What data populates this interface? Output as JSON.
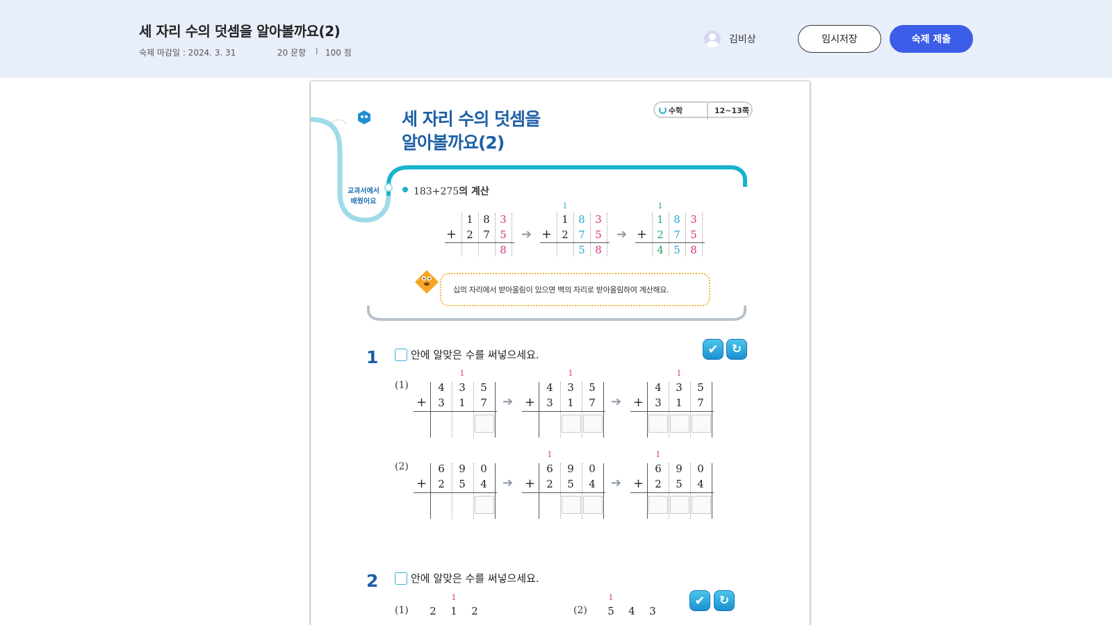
{
  "header": {
    "title": "세 자리 수의 덧셈을 알아볼까요(2)",
    "due_label": "숙제 마감일 : 2024. 3. 31",
    "question_count": "20 문항",
    "separator": "I",
    "points": "100 점",
    "user_name": "김비상",
    "save_label": "임시저장",
    "submit_label": "숙제 제출"
  },
  "sheet": {
    "title": "세 자리 수의 덧셈을\n알아볼까요(2)",
    "subject": "수학",
    "pages": "12~13쪽",
    "learned_label": "교과서에서\n배웠어요",
    "calc_title_expr": "183+275",
    "calc_title_suffix": "의 계산",
    "tip": "십의 자리에서 받아올림이 있으면 백의 자리로 받아올림하여 계산해요.",
    "q1": {
      "number": "1",
      "instruction": "안에 알맞은 수를 써넣으세요.",
      "part1_label": "(1)",
      "part2_label": "(2)"
    },
    "q2": {
      "number": "2",
      "instruction": "안에 알맞은 수를 써넣으세요.",
      "part1_label": "(1)",
      "part2_label": "(2)"
    },
    "carry": "1",
    "plus": "+",
    "arrow": "➔",
    "check_icon": "✔",
    "refresh_icon": "↻"
  },
  "example": {
    "top": [
      "1",
      "8",
      "3"
    ],
    "bottom": [
      "2",
      "7",
      "5"
    ],
    "step1_result": [
      "",
      "",
      "8"
    ],
    "step2_result": [
      "",
      "5",
      "8"
    ],
    "step3_result": [
      "4",
      "5",
      "8"
    ]
  },
  "q1_problems": [
    {
      "top": [
        "4",
        "3",
        "5"
      ],
      "bottom": [
        "3",
        "1",
        "7"
      ]
    },
    {
      "top": [
        "6",
        "9",
        "0"
      ],
      "bottom": [
        "2",
        "5",
        "4"
      ]
    }
  ],
  "q2_problems": [
    {
      "top": [
        "2",
        "1",
        "2"
      ]
    },
    {
      "top": [
        "5",
        "4",
        "3"
      ]
    }
  ],
  "colors": {
    "accent": "#3b5de7",
    "title_blue": "#1d5fa6",
    "teal": "#19b3cf",
    "carry_pink": "#d63384",
    "carry_blue": "#27a9d6",
    "carry_green": "#25a85f"
  }
}
